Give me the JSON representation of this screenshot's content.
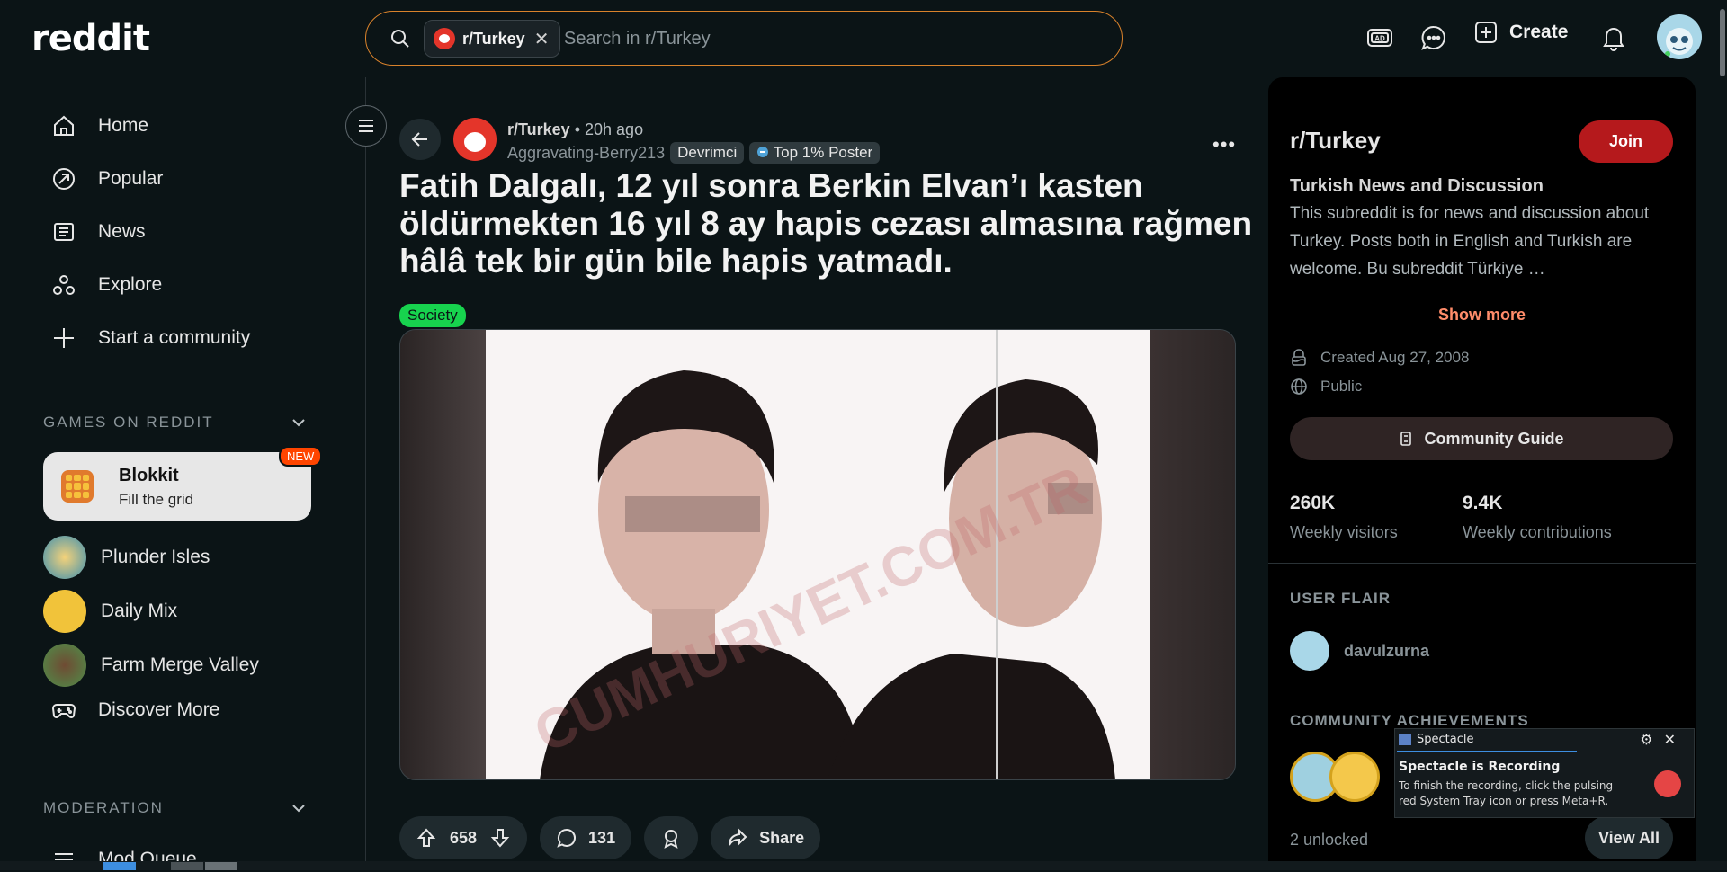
{
  "header": {
    "logo": "reddit",
    "search_chip": "r/Turkey",
    "search_placeholder": "Search in r/Turkey",
    "create_label": "Create"
  },
  "sidebar": {
    "nav": [
      {
        "label": "Home"
      },
      {
        "label": "Popular"
      },
      {
        "label": "News"
      },
      {
        "label": "Explore"
      },
      {
        "label": "Start a community"
      }
    ],
    "games_heading": "GAMES ON REDDIT",
    "featured_game": {
      "name": "Blokkit",
      "subtitle": "Fill the grid",
      "badge": "NEW"
    },
    "games": [
      {
        "label": "Plunder Isles"
      },
      {
        "label": "Daily Mix"
      },
      {
        "label": "Farm Merge Valley"
      },
      {
        "label": "Discover More"
      }
    ],
    "moderation_heading": "MODERATION",
    "mod_queue": "Mod Queue"
  },
  "post": {
    "subreddit": "r/Turkey",
    "time": "20h ago",
    "author": "Aggravating-Berry213",
    "author_flair": "Devrimci",
    "badge": "Top 1% Poster",
    "title": "Fatih Dalgalı, 12 yıl sonra Berkin Elvan’ı kasten öldürmekten 16 yıl 8 ay hapis cezası almasına rağmen hâlâ tek bir gün bile hapis yatmadı.",
    "flair": "Society",
    "votes": "658",
    "comments": "131",
    "share_label": "Share",
    "colors": {
      "flair_bg": "#17d34e",
      "accent": "#ff4500"
    }
  },
  "community": {
    "name": "r/Turkey",
    "join_label": "Join",
    "subtitle": "Turkish News and Discussion",
    "description": "This subreddit is for news and discussion about Turkey. Posts both in English and Turkish are welcome. Bu subreddit Türkiye …",
    "show_more": "Show more",
    "created": "Created Aug 27, 2008",
    "visibility": "Public",
    "guide_label": "Community Guide",
    "stats": [
      {
        "value": "260K",
        "label": "Weekly visitors"
      },
      {
        "value": "9.4K",
        "label": "Weekly contributions"
      }
    ],
    "user_flair_heading": "USER FLAIR",
    "username": "davulzurna",
    "achievements_heading": "COMMUNITY ACHIEVEMENTS",
    "unlocked": "2 unlocked",
    "view_all": "View All"
  },
  "spectacle": {
    "app": "Spectacle",
    "title": "Spectacle is Recording",
    "body": "To finish the recording, click the pulsing red System Tray icon or press Meta+R."
  }
}
